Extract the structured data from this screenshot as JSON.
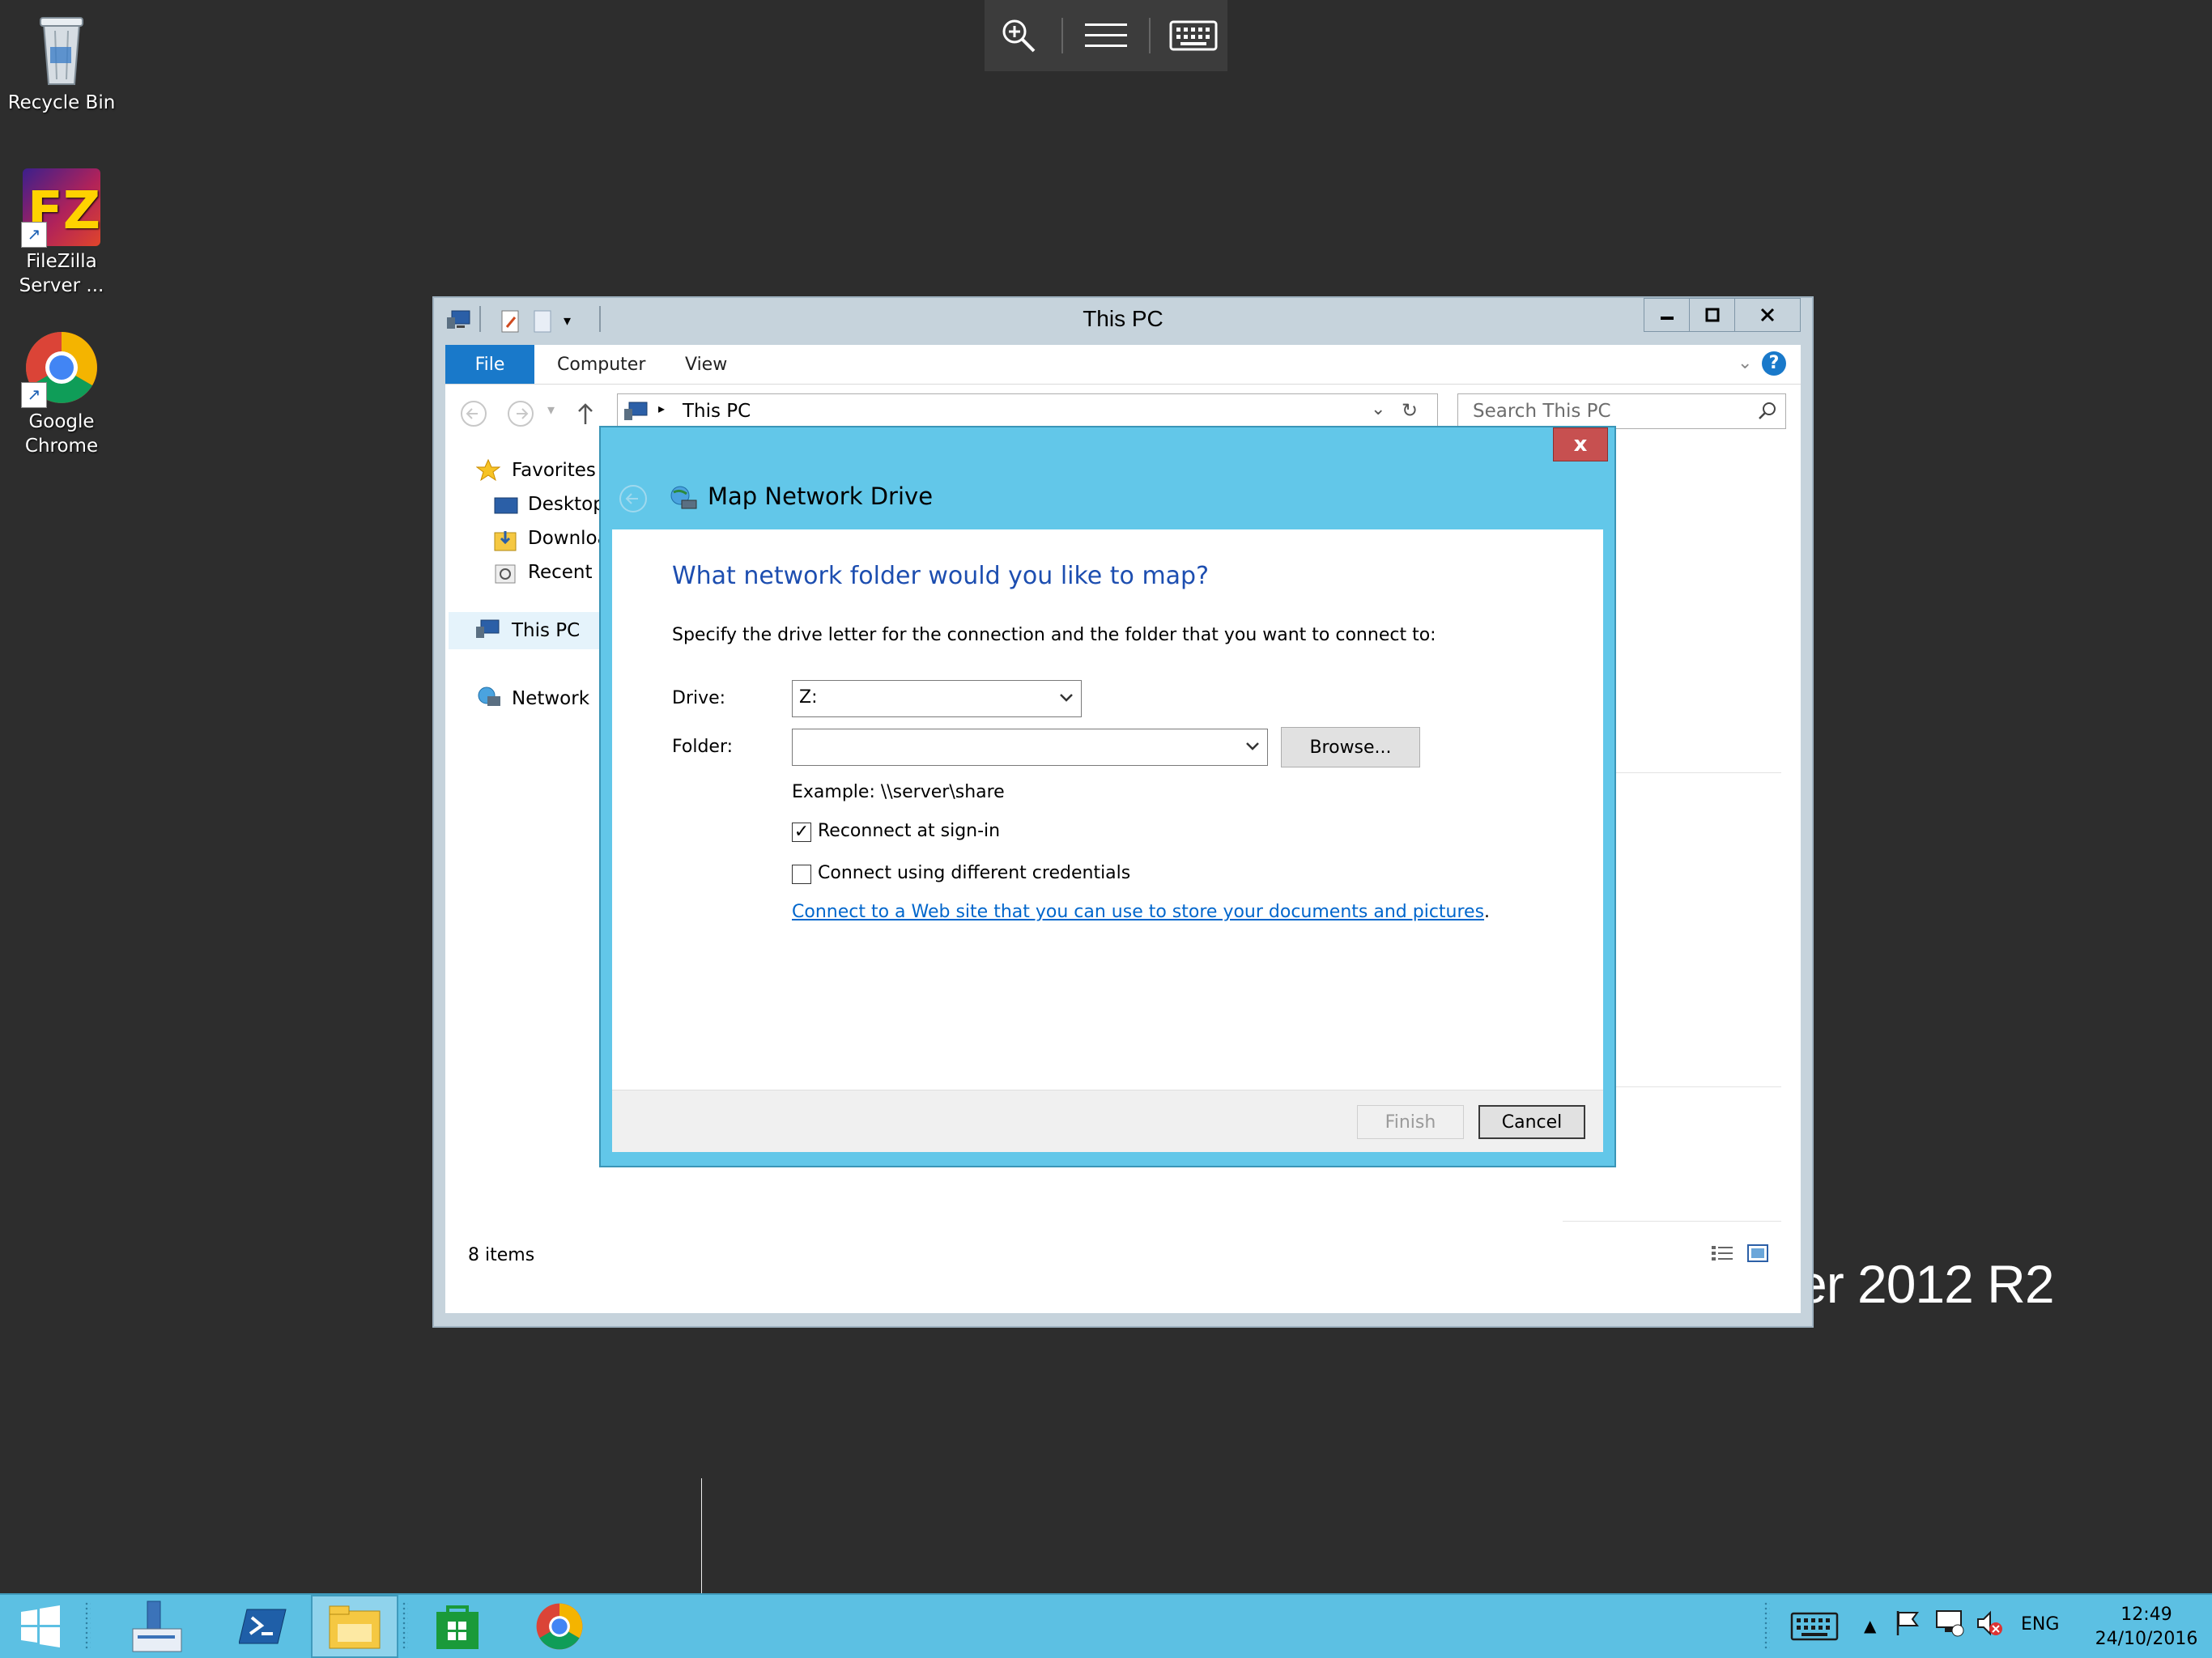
{
  "desktop": {
    "icons": [
      {
        "label": "Recycle Bin"
      },
      {
        "label": "FileZilla Server ..."
      },
      {
        "label": "Google Chrome"
      }
    ],
    "watermark": "er 2012 R2"
  },
  "explorer": {
    "title": "This PC",
    "ribbon_tabs": [
      "File",
      "Computer",
      "View"
    ],
    "address": "This PC",
    "search_placeholder": "Search This PC",
    "nav": {
      "favorites": "Favorites",
      "desktop": "Desktop",
      "downloads": "Downloa",
      "recent": "Recent p",
      "this_pc": "This PC",
      "network": "Network"
    },
    "status": "8 items"
  },
  "dialog": {
    "title": "Map Network Drive",
    "heading": "What network folder would you like to map?",
    "description": "Specify the drive letter for the connection and the folder that you want to connect to:",
    "drive_label": "Drive:",
    "drive_value": "Z:",
    "folder_label": "Folder:",
    "folder_value": "",
    "browse_label": "Browse...",
    "example": "Example: \\\\server\\share",
    "reconnect_label": "Reconnect at sign-in",
    "reconnect_checked": true,
    "credentials_label": "Connect using different credentials",
    "credentials_checked": false,
    "link_text": "Connect to a Web site that you can use to store your documents and pictures",
    "link_suffix": ".",
    "finish_label": "Finish",
    "cancel_label": "Cancel",
    "close_glyph": "x"
  },
  "taskbar": {
    "language": "ENG",
    "time": "12:49",
    "date": "24/10/2016"
  },
  "colors": {
    "accent": "#1979ca",
    "dialog_frame": "#62c7e9",
    "taskbar": "#5cc0e3",
    "close_red": "#c75050",
    "heading_blue": "#1d4eb0"
  }
}
